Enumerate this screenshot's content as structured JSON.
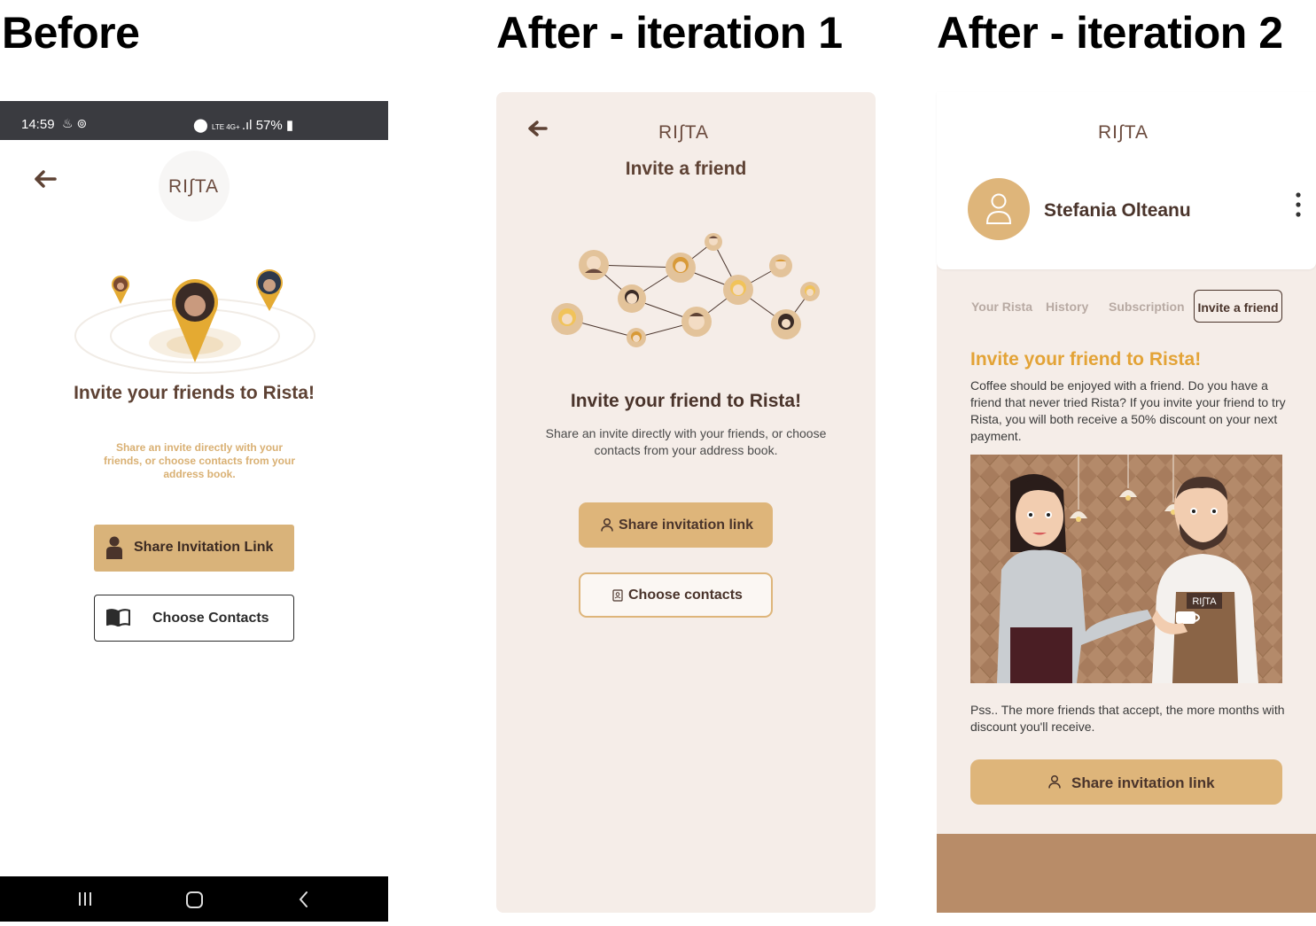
{
  "headings": {
    "before": "Before",
    "iteration1": "After - iteration 1",
    "iteration2": "After - iteration 2"
  },
  "brand": {
    "logo_text": "RI∫TA",
    "color_brown": "#5e4234",
    "color_gold": "#deb57a"
  },
  "before": {
    "status_time": "14:59",
    "status_battery": "57%",
    "title": "Invite your friends to Rista!",
    "subtitle": "Share an invite directly with your friends, or choose contacts from your address book.",
    "share_button": "Share Invitation Link",
    "contacts_button": "Choose Contacts",
    "icons": [
      "back-arrow-icon",
      "person-icon",
      "book-icon",
      "recents-icon",
      "home-icon",
      "back-icon"
    ]
  },
  "iteration1": {
    "screen_title": "Invite a friend",
    "title": "Invite your friend to Rista!",
    "subtitle": "Share an invite directly with your friends, or choose contacts from your address book.",
    "share_button": "Share invitation link",
    "contacts_button": "Choose contacts"
  },
  "iteration2": {
    "user_name": "Stefania Olteanu",
    "tabs": [
      "Your Rista",
      "History",
      "Subscription",
      "Invite a friend"
    ],
    "active_tab": "Invite a friend",
    "heading": "Invite your friend to Rista!",
    "body": "Coffee should be enjoyed with a friend. Do you have a friend that never tried Rista? If you invite your friend to try Rista, you will both receive a 50% discount on your next payment.",
    "apron_logo": "RI∫TA",
    "footnote": "Pss.. The more friends that accept, the more months with discount you'll receive.",
    "share_button": "Share invitation link"
  }
}
